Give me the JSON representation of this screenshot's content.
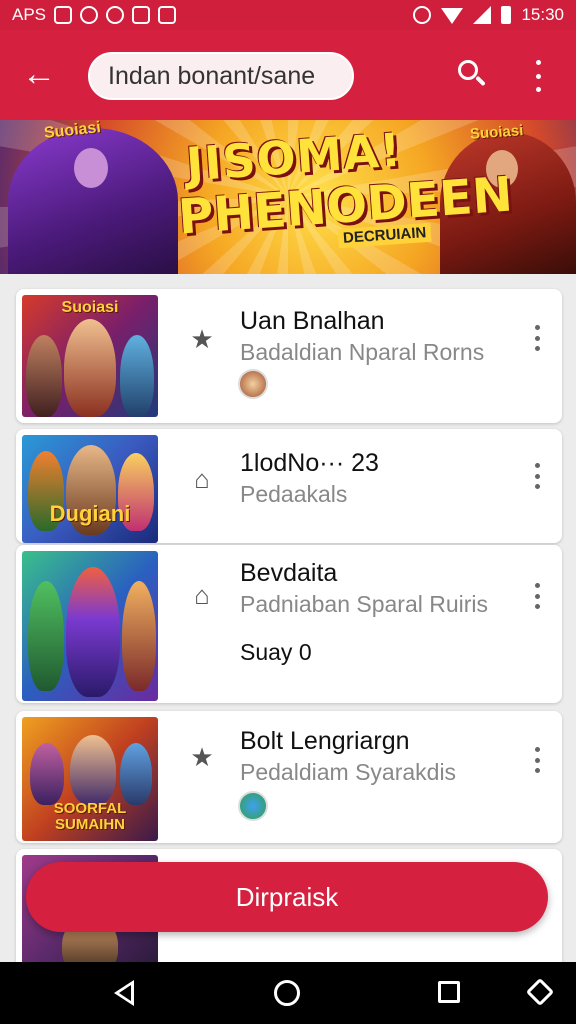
{
  "status_bar": {
    "carrier": "APS",
    "time": "15:30"
  },
  "app_bar": {
    "search_text": "Indan bonant/sane"
  },
  "banner": {
    "label_left": "Suoiasi",
    "label_right": "Suoiasi",
    "title_line1": "JISOMA!",
    "title_line2": "PHENODEEN",
    "subtitle": "DECRUIAIN"
  },
  "list": {
    "items": [
      {
        "title": "Uan Bnalhan",
        "subtitle": "Badaldian Nparal Rorns",
        "icon": "star-icon",
        "thumb_caption": "Suoiasi"
      },
      {
        "title": "1lodNo··· 23",
        "subtitle": "Pedaakals",
        "icon": "building-icon",
        "thumb_caption": "Dugiani"
      },
      {
        "title": "Bevdaita",
        "subtitle": "Padniaban Sparal Ruiris",
        "extra": "Suay 0",
        "icon": "shield-icon",
        "thumb_caption": ""
      },
      {
        "title": "Bolt Lengriargn",
        "subtitle": "Pedaldiam Syarakdis",
        "icon": "star-icon",
        "thumb_caption": "SOORFAL SUMAIHN"
      }
    ]
  },
  "fab": {
    "label": "Dirpraisk"
  }
}
